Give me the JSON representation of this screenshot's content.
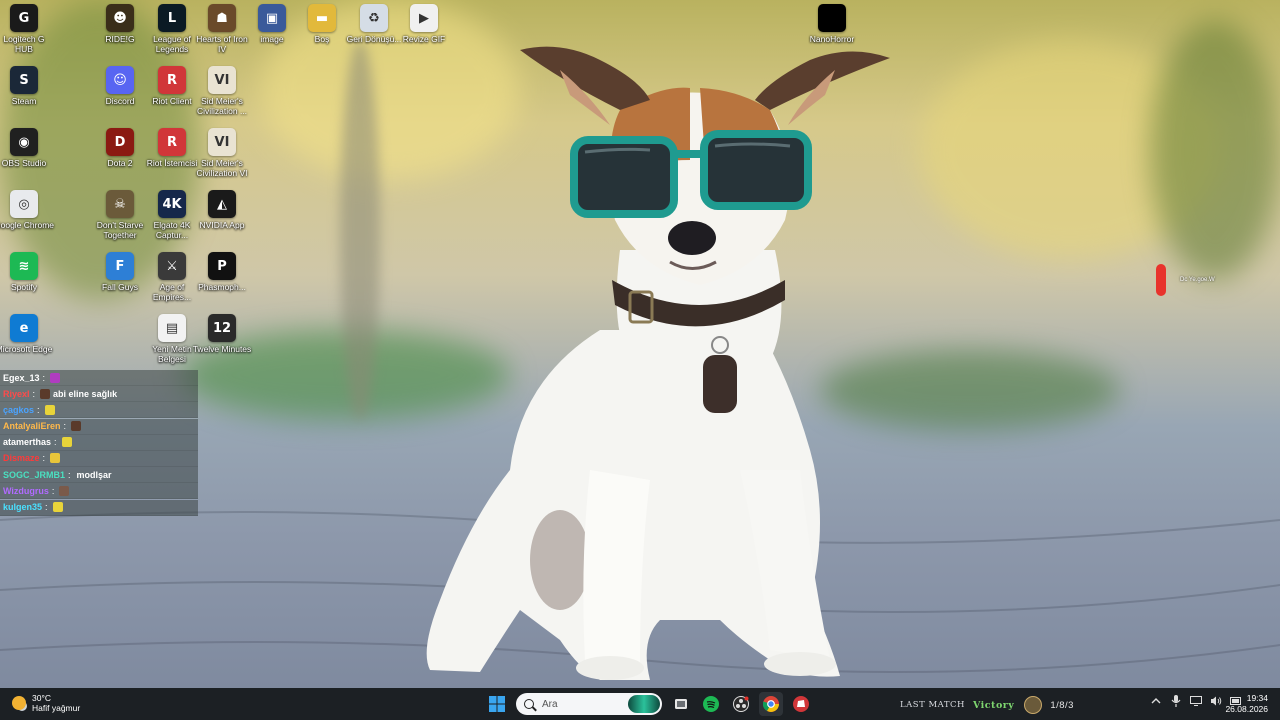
{
  "desktop_icons": [
    {
      "label": "Logitech G HUB",
      "icon": "logitech-g-icon",
      "color": "#1a1a1a"
    },
    {
      "label": "Steam",
      "icon": "steam-icon",
      "color": "#1b2838"
    },
    {
      "label": "OBS Studio",
      "icon": "obs-icon",
      "color": "#202020"
    },
    {
      "label": "Google Chrome",
      "icon": "chrome-icon",
      "color": "#e8eaed"
    },
    {
      "label": "Spotify",
      "icon": "spotify-icon",
      "color": "#1db954"
    },
    {
      "label": "Microsoft Edge",
      "icon": "edge-icon",
      "color": "#0f7bd3"
    },
    {
      "label": "RIDE!G",
      "icon": "ride-icon",
      "color": "#3a2e1a"
    },
    {
      "label": "Discord",
      "icon": "discord-icon",
      "color": "#5865f2"
    },
    {
      "label": "Dota 2",
      "icon": "dota-icon",
      "color": "#8b1a12"
    },
    {
      "label": "Don't Starve Together",
      "icon": "dont-starve-icon",
      "color": "#6b5a3a"
    },
    {
      "label": "Fall Guys",
      "icon": "fall-guys-icon",
      "color": "#2d7fd6"
    },
    {
      "label": "League of Legends",
      "icon": "league-icon",
      "color": "#0b1a24"
    },
    {
      "label": "Riot Client",
      "icon": "riot-icon",
      "color": "#d13639"
    },
    {
      "label": "Riot İstemcisi",
      "icon": "riot-icon",
      "color": "#d13639"
    },
    {
      "label": "Elgato 4K Captur...",
      "icon": "elgato-icon",
      "color": "#15284a"
    },
    {
      "label": "Age of Empires...",
      "icon": "aoe-icon",
      "color": "#3a3a3a"
    },
    {
      "label": "Yeni Metin Belgesi",
      "icon": "text-file-icon",
      "color": "#f2f2f2"
    },
    {
      "label": "Hearts of Iron IV",
      "icon": "hoi-icon",
      "color": "#6a4a2a"
    },
    {
      "label": "Sid Meier's Civilization ...",
      "icon": "civ-icon",
      "color": "#e9e3d2"
    },
    {
      "label": "Sid Meier's Civilization VI",
      "icon": "civ-icon",
      "color": "#e9e3d2"
    },
    {
      "label": "NVIDIA App",
      "icon": "nvidia-icon",
      "color": "#1a1a1a"
    },
    {
      "label": "Phasmoph...",
      "icon": "phasmophobia-icon",
      "color": "#111111"
    },
    {
      "label": "Twelve Minutes",
      "icon": "twelve-minutes-icon",
      "color": "#2a2a2a"
    },
    {
      "label": "image",
      "icon": "image-file-icon",
      "color": "#3a5a9a"
    },
    {
      "label": "Boş",
      "icon": "folder-icon",
      "color": "#e2b93b"
    },
    {
      "label": "Geri Dönüşü...",
      "icon": "recycle-bin-icon",
      "color": "#d5dde6"
    },
    {
      "label": "Revize GIF",
      "icon": "gif-file-icon",
      "color": "#f0f0f0"
    },
    {
      "label": "NanoHorror",
      "icon": "nanohorror-icon",
      "color": "#000000"
    }
  ],
  "icon_glyphs": {
    "Logitech G HUB": "G",
    "Steam": "S",
    "OBS Studio": "◉",
    "Google Chrome": "◎",
    "Spotify": "≋",
    "Microsoft Edge": "e",
    "RIDE!G": "☻",
    "Discord": "☺",
    "Dota 2": "D",
    "Don't Starve Together": "☠",
    "Fall Guys": "F",
    "League of Legends": "L",
    "Riot Client": "R",
    "Riot İstemcisi": "R",
    "Elgato 4K Captur...": "4K",
    "Age of Empires...": "⚔",
    "Yeni Metin Belgesi": "▤",
    "Hearts of Iron IV": "☗",
    "Sid Meier's Civilization ...": "VI",
    "Sid Meier's Civilization VI": "VI",
    "NVIDIA App": "◭",
    "Phasmoph...": "P",
    "Twelve Minutes": "12",
    "image": "▣",
    "Boş": "▬",
    "Geri Dönüşü...": "♻",
    "Revize GIF": "▶",
    "NanoHorror": ""
  },
  "chat": [
    {
      "user": "Egex_13",
      "color": "#ffffff",
      "msg": "",
      "emote": "#b03cc0"
    },
    {
      "user": "Riyexl",
      "color": "#ff4a4a",
      "msg": "abi eline sağlık",
      "emote": "#5a3a2a"
    },
    {
      "user": "çagkos",
      "color": "#4aa3ff",
      "msg": "",
      "emote": "#e8d43a"
    },
    {
      "user": "AntalyaliEren",
      "color": "#ffb84a",
      "msg": "",
      "emote": "#5a3a2a"
    },
    {
      "user": "atamerthas",
      "color": "#ffffff",
      "msg": "",
      "emote": "#e8d43a"
    },
    {
      "user": "Dismaze",
      "color": "#ff3a3a",
      "msg": "",
      "emote": "#e8c53a"
    },
    {
      "user": "SOGC_JRMB1",
      "color": "#4ae0c0",
      "msg": "modlşar",
      "emote": ""
    },
    {
      "user": "Wizdugrus",
      "color": "#b06bff",
      "msg": "",
      "emote": "#7a5a4a"
    },
    {
      "user": "kulgen35",
      "color": "#4ae0ff",
      "msg": "",
      "emote": "#e8d43a"
    }
  ],
  "float_widget": {
    "text": "Dc Ye.goe.W"
  },
  "taskbar": {
    "weather_temp": "30°C",
    "weather_desc": "Hafif yağmur",
    "search_placeholder": "Ara",
    "last_match_label": "LAST MATCH",
    "last_match_result": "Victory",
    "last_match_kda": "1/8/3",
    "time": "19:34",
    "date": "26.08.2026"
  }
}
